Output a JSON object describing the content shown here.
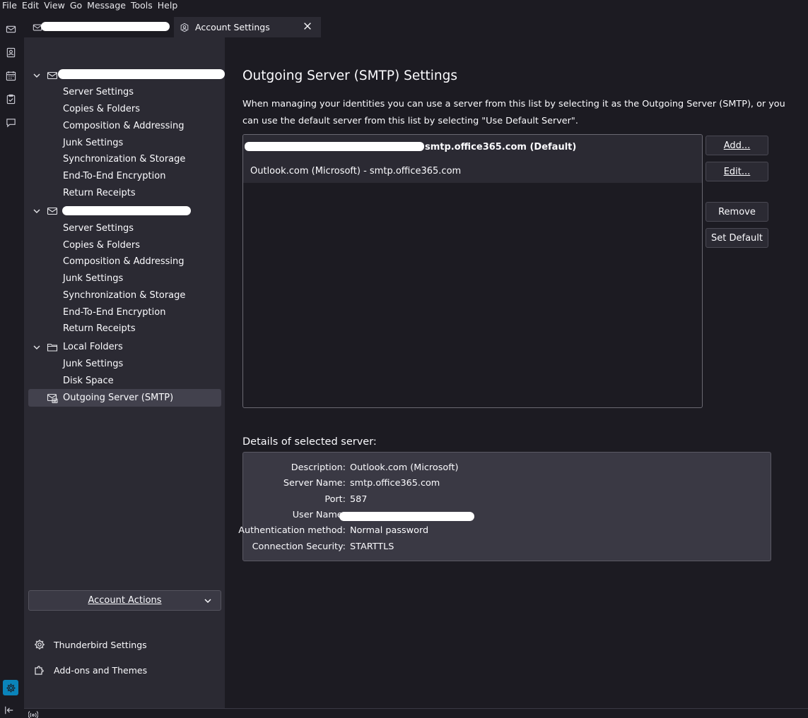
{
  "menubar": {
    "items": [
      "File",
      "Edit",
      "View",
      "Go",
      "Message",
      "Tools",
      "Help"
    ]
  },
  "tabs": [
    {
      "label": ""
    },
    {
      "label": "Account Settings"
    }
  ],
  "sidebar": {
    "accounts": [
      {
        "label": "",
        "items": [
          "Server Settings",
          "Copies & Folders",
          "Composition & Addressing",
          "Junk Settings",
          "Synchronization & Storage",
          "End-To-End Encryption",
          "Return Receipts"
        ]
      },
      {
        "label": "",
        "items": [
          "Server Settings",
          "Copies & Folders",
          "Composition & Addressing",
          "Junk Settings",
          "Synchronization & Storage",
          "End-To-End Encryption",
          "Return Receipts"
        ]
      },
      {
        "label": "Local Folders",
        "items": [
          "Junk Settings",
          "Disk Space"
        ]
      }
    ],
    "selected": "Outgoing Server (SMTP)",
    "account_actions": "Account Actions",
    "footer": {
      "settings": "Thunderbird Settings",
      "addons": "Add-ons and Themes"
    }
  },
  "main": {
    "title": "Outgoing Server (SMTP) Settings",
    "description": "When managing your identities you can use a server from this list by selecting it as the Outgoing Server (SMTP), or you can use the default server from this list by selecting \"Use Default Server\".",
    "servers": [
      {
        "label": "smtp.office365.com (Default)"
      },
      {
        "label": "Outlook.com (Microsoft) - smtp.office365.com"
      }
    ],
    "buttons": {
      "add": "Add...",
      "edit": "Edit...",
      "remove": "Remove",
      "set_default": "Set Default"
    },
    "details": {
      "title": "Details of selected server:",
      "rows": [
        {
          "label": "Description:",
          "value": "Outlook.com (Microsoft)"
        },
        {
          "label": "Server Name:",
          "value": "smtp.office365.com"
        },
        {
          "label": "Port:",
          "value": "587"
        },
        {
          "label": "User Name:",
          "value": ""
        },
        {
          "label": "Authentication method:",
          "value": "Normal password"
        },
        {
          "label": "Connection Security:",
          "value": "STARTTLS"
        }
      ]
    }
  },
  "colors": {
    "background": "#1c1b22",
    "sidebar": "#2b2a33",
    "accent": "#0a84ba"
  }
}
